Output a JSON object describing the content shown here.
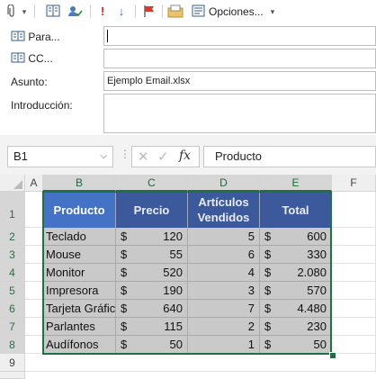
{
  "toolbar": {
    "options_label": "Opciones...",
    "icons": [
      "attach-icon",
      "address-book-icon",
      "check-names-icon",
      "high-importance-icon",
      "low-importance-icon",
      "flag-icon",
      "folder-icon",
      "options-icon",
      "dropdown-icon"
    ]
  },
  "email": {
    "to_label": "Para...",
    "cc_label": "CC...",
    "subject_label": "Asunto:",
    "subject_value": "Ejemplo Email.xlsx",
    "intro_label": "Introducción:"
  },
  "formula_bar": {
    "name_box": "B1",
    "fx": "fx",
    "formula": "Producto"
  },
  "sheet": {
    "columns": [
      "A",
      "B",
      "C",
      "D",
      "E",
      "F"
    ],
    "rows": [
      "1",
      "2",
      "3",
      "4",
      "5",
      "6",
      "7",
      "8",
      "9"
    ],
    "headers": [
      "Producto",
      "Precio",
      "Artículos Vendidos",
      "Total"
    ],
    "currency": "$",
    "data": [
      {
        "producto": "Teclado",
        "precio": "120",
        "vendidos": "5",
        "total": "600"
      },
      {
        "producto": "Mouse",
        "precio": "55",
        "vendidos": "6",
        "total": "330"
      },
      {
        "producto": "Monitor",
        "precio": "520",
        "vendidos": "4",
        "total": "2.080"
      },
      {
        "producto": "Impresora",
        "precio": "190",
        "vendidos": "3",
        "total": "570"
      },
      {
        "producto": "Tarjeta Gráfica",
        "precio": "640",
        "vendidos": "7",
        "total": "4.480"
      },
      {
        "producto": "Parlantes",
        "precio": "115",
        "vendidos": "2",
        "total": "230"
      },
      {
        "producto": "Audífonos",
        "precio": "50",
        "vendidos": "1",
        "total": "50"
      }
    ]
  },
  "colors": {
    "header_fill": "#3c5a9b",
    "data_fill": "#c9c9c9",
    "selection": "#1e7145"
  }
}
